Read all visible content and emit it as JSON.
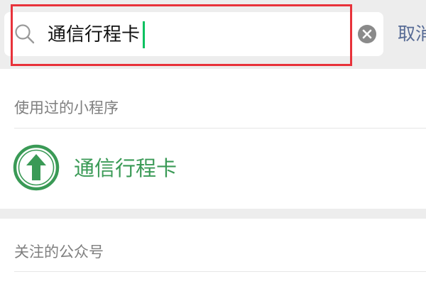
{
  "search": {
    "query": "通信行程卡",
    "cancel_label": "取消"
  },
  "sections": {
    "used_miniprograms": {
      "header": "使用过的小程序",
      "items": [
        {
          "name": "通信行程卡",
          "icon": "upward-arrow-icon"
        }
      ]
    },
    "followed_accounts": {
      "header": "关注的公众号"
    }
  },
  "colors": {
    "accent_green": "#3a9a56",
    "highlight_red": "#e8323a",
    "cancel_blue": "#576b95"
  }
}
